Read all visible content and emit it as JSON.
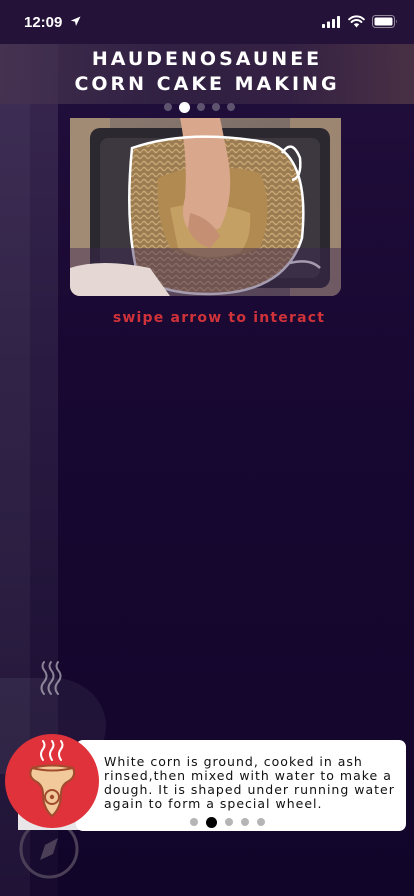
{
  "status_bar": {
    "time": "12:09",
    "location_icon": "location-arrow-icon",
    "signal_icon": "cellular-signal-icon",
    "wifi_icon": "wifi-icon",
    "battery_icon": "battery-icon"
  },
  "header": {
    "title_line1": "HAUDENOSAUNEE",
    "title_line2": "CORN CAKE MAKING"
  },
  "carousel": {
    "page_count": 5,
    "current_page": 2
  },
  "photo": {
    "subject_icon": "basket-photo"
  },
  "hint": {
    "text": "swipe arrow to interact"
  },
  "info_card": {
    "text": "White corn is ground, cooked in ash rinsed,then mixed with water to make a dough. It is shaped under running water again to form a special wheel.",
    "page_count": 5,
    "current_page": 2
  },
  "controls": {
    "steam_icon": "steam-icon",
    "food_icon": "food-bowl-icon",
    "compass_icon": "compass-icon"
  },
  "colors": {
    "background": "#14062b",
    "accent_red": "#e0323a",
    "hint_red": "#d0323a",
    "card_bg": "#ffffff"
  }
}
